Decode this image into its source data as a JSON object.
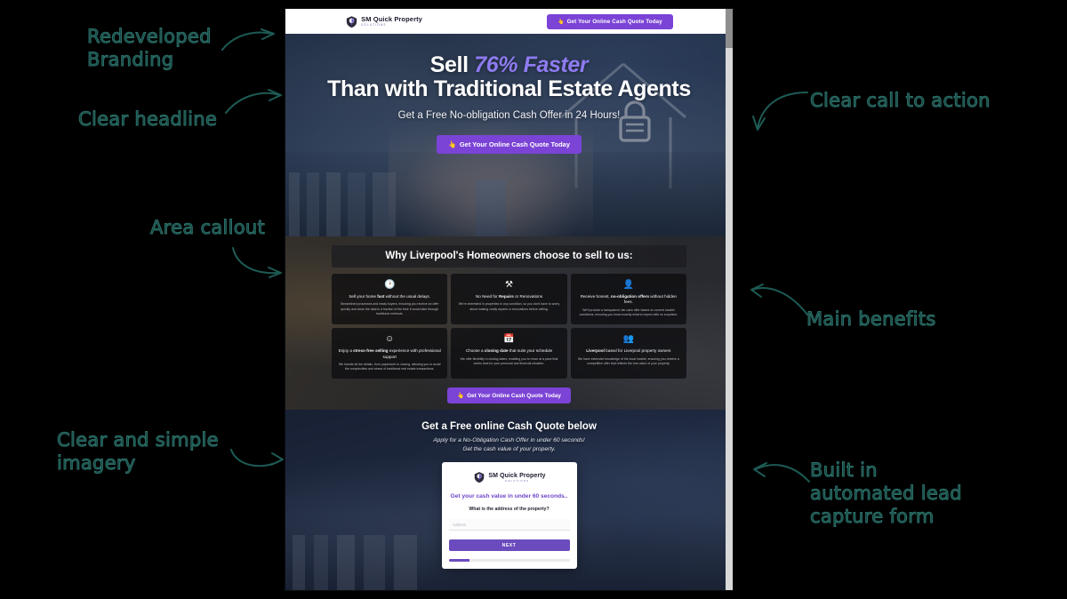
{
  "annotations": [
    {
      "id": "redeveloped-branding",
      "text": "Redeveloped\nBranding"
    },
    {
      "id": "clear-headline",
      "text": "Clear headline"
    },
    {
      "id": "area-callout",
      "text": "Area callout"
    },
    {
      "id": "clear-imagery",
      "text": "Clear and simple\nimagery"
    },
    {
      "id": "clear-cta",
      "text": "Clear call to action"
    },
    {
      "id": "main-benefits",
      "text": "Main benefits"
    },
    {
      "id": "lead-capture",
      "text": "Built in\nautomated lead\ncapture form"
    }
  ],
  "brand": {
    "name": "SM Quick Property",
    "subtitle": "SOLUTIONS",
    "mark_icon": "shield-location-pin-icon"
  },
  "header": {
    "cta_label": "Get Your Online Cash Quote Today",
    "cta_icon": "cursor-click-icon"
  },
  "hero": {
    "headline_part1": "Sell",
    "headline_accent": "76% Faster",
    "headline_part2": "Than with Traditional Estate Agents",
    "subheadline": "Get a Free No-obligation Cash Offer in 24 Hours!",
    "cta_label": "Get Your Online Cash Quote Today",
    "cta_icon": "cursor-click-icon",
    "background_imagery": "house-outline-lock-hands-city",
    "accent_color": "#8e7bf0",
    "cta_color": "#7b43d6"
  },
  "benefits": {
    "title": "Why Liverpool's Homeowners choose to sell to us:",
    "cta_label": "Get Your Online Cash Quote Today",
    "cta_icon": "cursor-click-icon",
    "cards": [
      {
        "icon": "clock-icon",
        "title_pre": "Sell your home ",
        "title_bold": "fast",
        "title_post": " without the usual delays.",
        "body": "Streamlined processes and ready buyers, ensuring you receive an offer quickly and close the deal in a fraction of the time it would take through traditional methods."
      },
      {
        "icon": "tools-icon",
        "title_pre": "No Need for ",
        "title_bold": "Repairs",
        "title_post": " or Renovations",
        "body": "We're interested in properties in any condition, so you don't have to worry about making costly repairs or renovations before selling."
      },
      {
        "icon": "person-check-icon",
        "title_pre": "Receive honest, ",
        "title_bold": "no-obligation offers",
        "title_post": " without hidden fees.",
        "body": "We'll provide a transparent, fair cash offer based on current market conditions, ensuring you know exactly what to expect with no surprises."
      },
      {
        "icon": "smiley-icon",
        "title_pre": "Enjoy a ",
        "title_bold": "stress-free selling",
        "title_post": " experience with professional support",
        "body": "We handle all the details, from paperwork to closing, allowing you to avoid the complexities and stress of traditional real estate transactions."
      },
      {
        "icon": "calendar-icon",
        "title_pre": "Choose a ",
        "title_bold": "closing date",
        "title_post": " that suits your schedule",
        "body": "We offer flexibility in closing dates, enabling you to move at a pace that works best for your personal and financial situation."
      },
      {
        "icon": "people-group-icon",
        "title_pre": "",
        "title_bold": "Liverpool",
        "title_post": " based for Liverpool property owners",
        "body": "We have extensive knowledge of the local market, ensuring you receive a competitive offer that reflects the true value of your property."
      }
    ]
  },
  "quote": {
    "title": "Get a Free online Cash Quote below",
    "line1": "Apply for a No-Obligation Cash Offer in under 60 seconds!",
    "line2": "Get the cash value of your property.",
    "form": {
      "heading": "Get your cash value in under 60 seconds..",
      "question": "What is the address of the property?",
      "address_placeholder": "Address",
      "address_value": "",
      "next_label": "NEXT",
      "progress_percent": 17
    }
  },
  "browser": {
    "scrollbar": "vertical-scrollbar"
  }
}
